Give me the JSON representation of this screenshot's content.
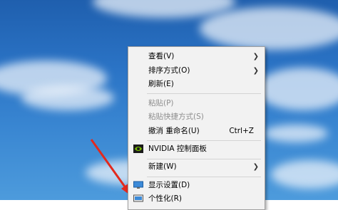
{
  "colors": {
    "accent": "#2b74c6",
    "menu_bg": "#f2f2f2",
    "disabled": "#8d8d8d",
    "annotation": "#e2291d"
  },
  "context_menu": {
    "items": [
      {
        "label": "查看(V)",
        "submenu": true
      },
      {
        "label": "排序方式(O)",
        "submenu": true
      },
      {
        "label": "刷新(E)"
      },
      {
        "label": "粘贴(P)",
        "disabled": true
      },
      {
        "label": "粘贴快捷方式(S)",
        "disabled": true
      },
      {
        "label": "撤消 重命名(U)",
        "accelerator": "Ctrl+Z"
      },
      {
        "label": "NVIDIA 控制面板",
        "icon": "nvidia-icon"
      },
      {
        "label": "新建(W)",
        "submenu": true
      },
      {
        "label": "显示设置(D)",
        "icon": "display-settings-icon"
      },
      {
        "label": "个性化(R)",
        "icon": "personalize-icon"
      }
    ]
  }
}
